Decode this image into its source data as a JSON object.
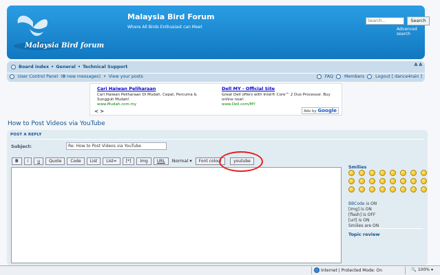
{
  "header": {
    "site_title": "Malaysia Bird Forum",
    "site_description": "Where All Birds Enthusiast can Meet",
    "logo_text": "Malaysia Bird forum",
    "search_placeholder": "Search...",
    "search_button": "Search",
    "advanced_search": "Advanced search"
  },
  "nav": {
    "breadcrumbs": [
      "Board index",
      "General",
      "Technical Support"
    ],
    "font_toggle": "A A",
    "ucp_label": "User Control Panel",
    "new_messages_count": "0",
    "new_messages_suffix": "new messages",
    "view_posts": "View your posts",
    "faq": "FAQ",
    "members": "Members",
    "logout": "Logout [ dance4rain ]"
  },
  "ads": {
    "ad1": {
      "title": "Cari Haiwan Peliharaan",
      "text": "Cari Haiwan Peliharaan Di Mudah. Cepat, Percuma & Sungguh Mudah!",
      "url": "www.Mudah.com.my"
    },
    "ad2": {
      "title": "Dell MY - Official Site",
      "text": "Great Dell offers with Intel® Core™ 2 Duo Processor. Buy online now!",
      "url": "www.Dell.com/MY"
    },
    "nav_arrows": "< >",
    "ads_by": "Ads by",
    "ads_brand": "Google"
  },
  "page_title": "How to Post Videos via YouTube",
  "post_panel": {
    "heading": "POST A REPLY",
    "subject_label": "Subject:",
    "subject_value": "Re: How to Post Videos via YouTube",
    "toolbar": {
      "bold": "B",
      "italic": "i",
      "underline": "u",
      "quote": "Quote",
      "code": "Code",
      "list": "List",
      "list_ordered": "List=",
      "list_item": "[*]",
      "img": "Img",
      "url": "URL",
      "font_size": "Normal",
      "font_colour": "Font colour",
      "youtube": "youtube"
    },
    "smilies_title": "Smilies",
    "smilies_count": 24,
    "status": {
      "bbcode_label": "BBCode",
      "bbcode_state": "is ON",
      "img": "[img] is ON",
      "flash": "[flash] is OFF",
      "url": "[url] is ON",
      "smilies": "Smilies are ON"
    },
    "topic_review": "Topic review"
  },
  "browser_status": {
    "zone": "Internet | Protected Mode: On",
    "zoom": "100%"
  },
  "colors": {
    "header_blue": "#1c8bd4",
    "nav_bg": "#cadceb",
    "panel_bg": "#e1ebf2",
    "link": "#105289",
    "highlight_circle": "#e0201f"
  }
}
